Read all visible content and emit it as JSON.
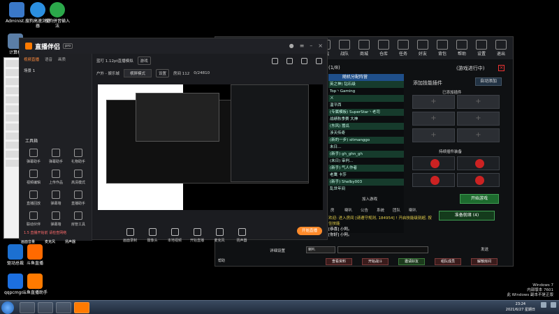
{
  "desktop": {
    "icons": [
      {
        "label": "Administ...",
        "color": "#3a78c8"
      },
      {
        "label": "搜狗高速浏览器",
        "color": "#2b8fe0"
      },
      {
        "label": "搜狗拼音输入法",
        "color": "#2ba84a"
      },
      {
        "label": "计算机",
        "color": "#5b7ea6"
      },
      {
        "label": "驱动总裁",
        "color": "#1c70d1"
      },
      {
        "label": "斗鱼直播",
        "color": "#ff6a00"
      },
      {
        "label": "qqpcmgr...",
        "color": "#1c6fe0"
      },
      {
        "label": "斗鱼直播助手",
        "color": "#ff7a00"
      }
    ]
  },
  "stream_app": {
    "logo": "直播伴侣",
    "badge": "pro",
    "tabs": [
      "视频直播",
      "语音",
      "画质"
    ],
    "scene": "场景 1",
    "stream_title": "蓝叮 1.12pt直播模拟",
    "category_chip": "游戏",
    "room_select": "户外 - 娱乐城",
    "mode_select": "横屏模式",
    "settings_chip": "设置",
    "id_text": "房间 112",
    "time_text": "0/24810",
    "tools_title": "工具箱",
    "tools": [
      [
        "弹幕助手",
        "弹幕助手",
        "礼物助手"
      ],
      [
        "视频编辑",
        "上传作品",
        "高清模式"
      ],
      [
        "直播回放",
        "弹幕墙",
        "直播助手"
      ],
      [
        "联动伙伴",
        "弹幕墙",
        "房管工具"
      ]
    ],
    "side_footer": "1.5 直播开始前 请检查网络",
    "controls": [
      "画面录制",
      "摄像头",
      "本地视频",
      "开始直播",
      "麦克风",
      "扬声器"
    ],
    "go_live": "开始直播",
    "preview_label": "直播画面预览"
  },
  "midbar": [
    "画面音量",
    "麦克风",
    "扬声器"
  ],
  "game_window": {
    "top_items": [
      "游戏",
      "战队",
      "商城",
      "仓库",
      "任务",
      "好友",
      "背包",
      "帮助",
      "设置",
      "退出"
    ],
    "room_id": "(1/8)",
    "status": "(游戏进行中)",
    "list_header": "(1/4)",
    "list_subheader": "随机分配阵营",
    "players": [
      "英之神) 钻石级",
      "Top丶Gaming",
      "ㄨ",
      "温平西",
      "(专属模板) SuperStar丶老司",
      "战绩秋季赛 大神",
      "(东风) 嚣瓜",
      "涉天传奇",
      "(新的一步) sitmanggo",
      "未日...",
      "(新手) gh_ghn_gh",
      "(未日) 审判...",
      "(新手) 气人作者",
      "老鹰 卡莎",
      "(新手) Shelby003",
      "乱世年间"
    ],
    "plugins_title": "添加技能插件",
    "auto_add": "自动添加",
    "added_header": "已添加插件",
    "owned_header": "持续插件装备",
    "start_game": "开始游戏",
    "join_btn": "加入游戏",
    "ready_btn": "准备就绪 (4)",
    "tabs": [
      "房",
      "喇叭",
      "公告",
      "系统",
      "团队",
      "喇叭"
    ],
    "chat": [
      "欢迎: 进入房间 [请遵守规则, 184954] ! 开启技能级别超, 按住技能",
      "[恭喜] 小阿。",
      "[你好] 小阿。"
    ],
    "chat_input_label": "喇叭",
    "send_btn": "发送",
    "bottom_left": "详细设置",
    "bottom_buttons": [
      "查看资料",
      "开始战斗",
      "邀请好友",
      "组队成员",
      "解散房间"
    ],
    "bottom_help": "帮助"
  },
  "taskbar": {
    "clock_time": "23:24",
    "clock_date": "2021/6/27 星期日"
  },
  "watermark": {
    "line1": "Windows 7",
    "line2": "内部版本 7601",
    "line3": "此 Windows 副本不是正版"
  }
}
